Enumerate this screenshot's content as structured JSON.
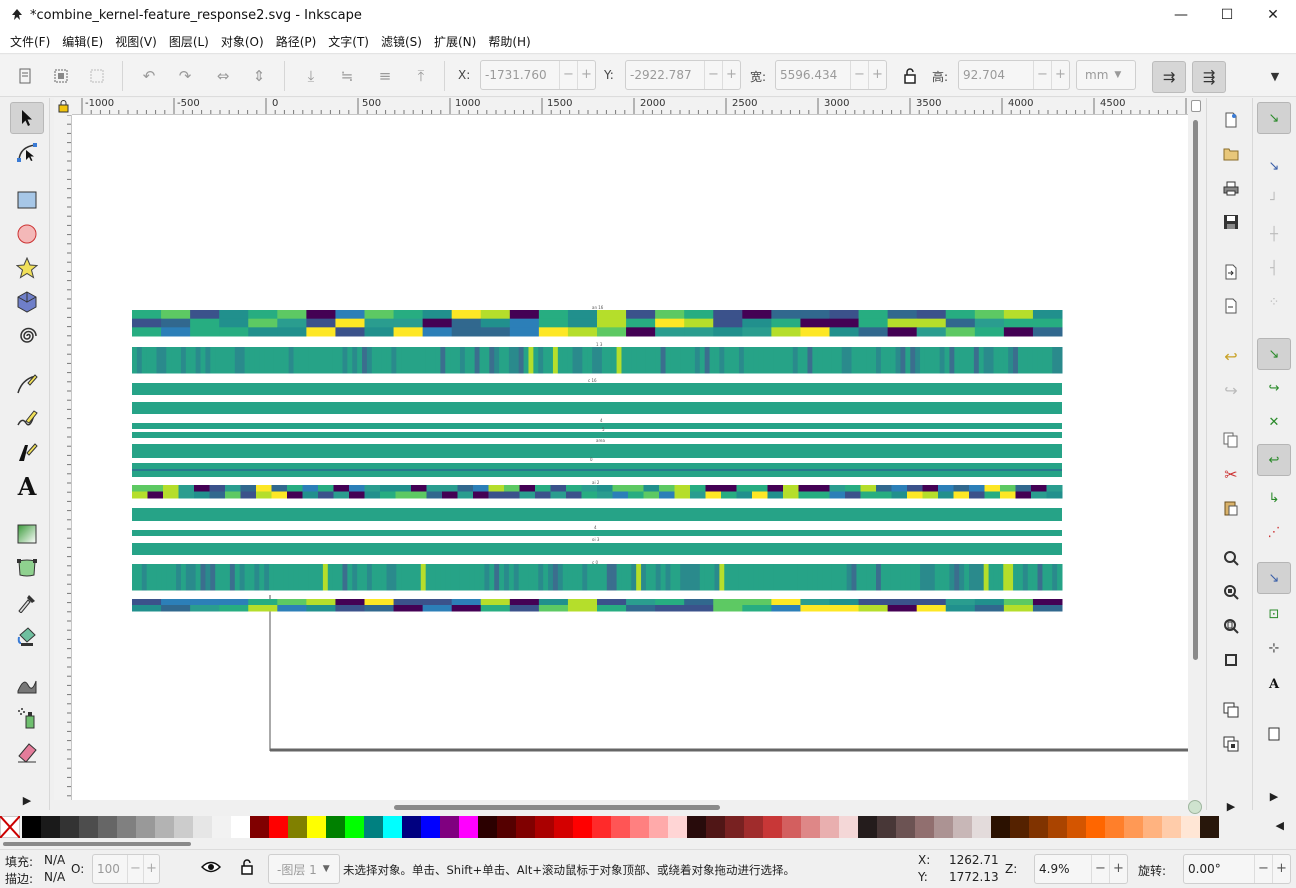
{
  "window": {
    "title": "*combine_kernel-feature_response2.svg - Inkscape",
    "minimize_glyph": "—",
    "maximize_glyph": "☐",
    "close_glyph": "✕"
  },
  "menu": [
    "文件(F)",
    "编辑(E)",
    "视图(V)",
    "图层(L)",
    "对象(O)",
    "路径(P)",
    "文字(T)",
    "滤镜(S)",
    "扩展(N)",
    "帮助(H)"
  ],
  "controls": {
    "x_label": "X:",
    "x_value": "-1731.760",
    "y_label": "Y:",
    "y_value": "-2922.787",
    "w_label": "宽:",
    "w_value": "5596.434",
    "h_label": "高:",
    "h_value": "92.704",
    "unit": "mm",
    "minus": "−",
    "plus": "+"
  },
  "ruler": {
    "h_ticks": [
      "-1000",
      "-500",
      "0",
      "500",
      "1000",
      "1500",
      "2000",
      "2500",
      "3000",
      "3500",
      "4000",
      "4500"
    ]
  },
  "canvas": {
    "labels": [
      "an 16",
      "1 3",
      "c 16",
      "4",
      "5",
      "area",
      "0",
      "ai 2",
      "4",
      "oi 3",
      "c 0"
    ]
  },
  "palette": {
    "colors": [
      "#000000",
      "#1a1a1a",
      "#333333",
      "#4d4d4d",
      "#666666",
      "#808080",
      "#999999",
      "#b3b3b3",
      "#cccccc",
      "#e6e6e6",
      "#f2f2f2",
      "#ffffff",
      "#800000",
      "#ff0000",
      "#808000",
      "#ffff00",
      "#008000",
      "#00ff00",
      "#008080",
      "#00ffff",
      "#000080",
      "#0000ff",
      "#800080",
      "#ff00ff",
      "#2b0000",
      "#550000",
      "#800000",
      "#aa0000",
      "#d40000",
      "#ff0000",
      "#ff2a2a",
      "#ff5555",
      "#ff8080",
      "#ffaaaa",
      "#ffd5d5",
      "#280b0b",
      "#501616",
      "#782121",
      "#a02c2c",
      "#c83737",
      "#d35f5f",
      "#de8787",
      "#e9afaf",
      "#f4d7d7",
      "#241c1c",
      "#483737",
      "#6c5353",
      "#916f6f",
      "#ac9393",
      "#c8b7b7",
      "#e3dbdb",
      "#2b1100",
      "#552200",
      "#803300",
      "#aa4400",
      "#d45500",
      "#ff6600",
      "#ff7f2a",
      "#ff9955",
      "#ffb380",
      "#ffccaa",
      "#ffe6d5",
      "#28170b"
    ]
  },
  "status": {
    "fill_label": "填充:",
    "fill_value": "N/A",
    "stroke_label": "描边:",
    "stroke_value": "N/A",
    "opacity_label": "O:",
    "opacity_value": "100",
    "layer_value": "-图层 1",
    "message": "未选择对象。单击、Shift+单击、Alt+滚动鼠标于对象顶部、或绕着对象拖动进行选择。",
    "cursor_x_label": "X:",
    "cursor_x": "1262.71",
    "cursor_y_label": "Y:",
    "cursor_y": "1772.13",
    "zoom_label": "Z:",
    "zoom_value": "4.9%",
    "rotate_label": "旋转:",
    "rotate_value": "0.00°"
  }
}
